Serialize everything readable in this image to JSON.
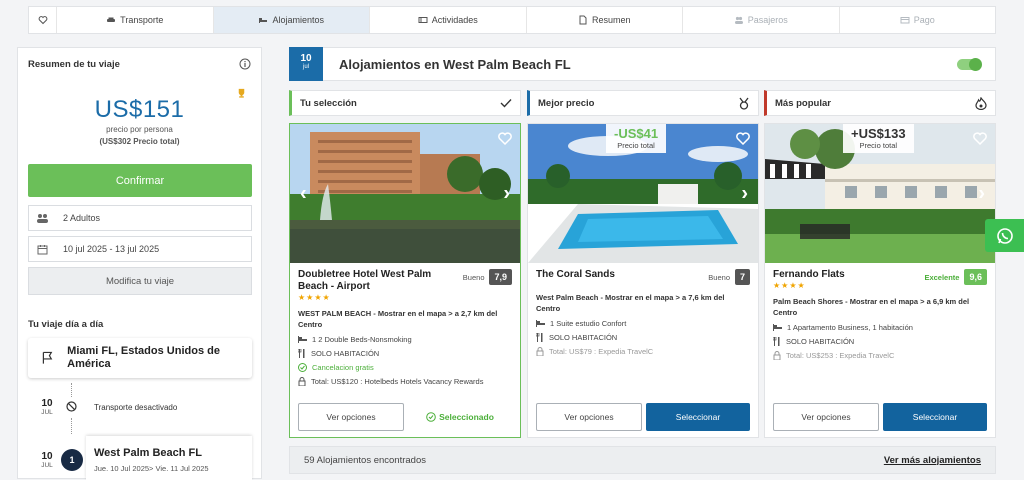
{
  "steps": [
    {
      "label": "Transporte",
      "icon": "car-icon"
    },
    {
      "label": "Alojamientos",
      "icon": "bed-icon"
    },
    {
      "label": "Actividades",
      "icon": "ticket-icon"
    },
    {
      "label": "Resumen",
      "icon": "document-icon"
    },
    {
      "label": "Pasajeros",
      "icon": "users-icon"
    },
    {
      "label": "Pago",
      "icon": "card-icon"
    }
  ],
  "sidebar": {
    "title": "Resumen de tu viaje",
    "price": "US$151",
    "per_person": "precio por persona",
    "total": "(US$302 Precio total)",
    "confirm": "Confirmar",
    "travellers": "2 Adultos",
    "dates": "10 jul 2025 - 13 jul 2025",
    "modify": "Modifica tu viaje",
    "day_by_day": "Tu viaje día a día",
    "origin": "Miami FL, Estados Unidos de América",
    "timeline": [
      {
        "day": "10",
        "month": "JUL",
        "text": "Transporte desactivado"
      },
      {
        "day": "10",
        "month": "JUL",
        "num": "1",
        "city": "West Palm Beach FL",
        "range": "Jue. 10 Jul 2025> Vie. 11 Jul 2025"
      }
    ]
  },
  "main": {
    "date_day": "10",
    "date_month": "jul",
    "title": "Alojamientos en West Palm Beach FL",
    "columns": [
      {
        "header": "Tu selección",
        "accent": "#6bbf59",
        "hotel": "Doubletree Hotel West Palm Beach - Airport",
        "rating_word": "Bueno",
        "rating": "7,9",
        "stars": "★★★★",
        "location": "WEST PALM BEACH - Mostrar en el mapa > a 2,7 km del Centro",
        "room": "1 2 Double Beds-Nonsmoking",
        "board": "SOLO HABITACIÓN",
        "cancel": "Cancelacion gratis",
        "total": "Total: US$120 : Hotelbeds Hotels Vacancy Rewards",
        "btn_options": "Ver opciones",
        "btn_selected": "Seleccionado"
      },
      {
        "header": "Mejor precio",
        "accent": "#1b6ca8",
        "badge_value": "-US$41",
        "badge_label": "Precio total",
        "hotel": "The Coral Sands",
        "rating_word": "Bueno",
        "rating": "7",
        "location": "West Palm Beach - Mostrar en el mapa > a 7,6 km del Centro",
        "room": "1 Suite estudio Confort",
        "board": "SOLO HABITACIÓN",
        "total": "Total: US$79 : Expedia TravelC",
        "btn_options": "Ver opciones",
        "btn_select": "Seleccionar"
      },
      {
        "header": "Más popular",
        "accent": "#c0392b",
        "badge_value": "+US$133",
        "badge_label": "Precio total",
        "hotel": "Fernando Flats",
        "rating_word": "Excelente",
        "rating": "9,6",
        "stars": "★★★★",
        "location": "Palm Beach Shores - Mostrar en el mapa > a 6,9 km del Centro",
        "room": "1 Apartamento Business, 1 habitación",
        "board": "SOLO HABITACIÓN",
        "total": "Total: US$253 : Expedia TravelC",
        "btn_options": "Ver opciones",
        "btn_select": "Seleccionar"
      }
    ],
    "found": "59 Alojamientos encontrados",
    "more": "Ver más alojamientos"
  }
}
